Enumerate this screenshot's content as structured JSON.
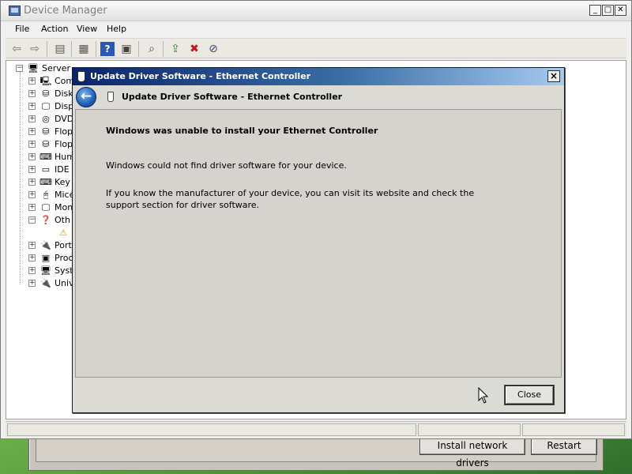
{
  "background_window": {
    "buttons": {
      "install_network_drivers": "Install network drivers",
      "restart": "Restart"
    }
  },
  "device_manager": {
    "title": "Device Manager",
    "menu": [
      "File",
      "Action",
      "View",
      "Help"
    ],
    "toolbar_icons": [
      "back-icon",
      "forward-icon",
      "show-hide-icon",
      "properties-icon",
      "help-icon",
      "action-icon",
      "scan-hardware-icon",
      "update-driver-icon",
      "uninstall-icon",
      "disable-icon"
    ],
    "tree": {
      "root": "Server",
      "nodes": [
        {
          "label": "Com",
          "expander": "+"
        },
        {
          "label": "Disk",
          "expander": "+"
        },
        {
          "label": "Disp",
          "expander": "+"
        },
        {
          "label": "DVD",
          "expander": "+"
        },
        {
          "label": "Flop",
          "expander": "+"
        },
        {
          "label": "Flop",
          "expander": "+"
        },
        {
          "label": "Hum",
          "expander": "+"
        },
        {
          "label": "IDE",
          "expander": "+"
        },
        {
          "label": "Key",
          "expander": "+"
        },
        {
          "label": "Mice",
          "expander": "+"
        },
        {
          "label": "Mon",
          "expander": "+"
        },
        {
          "label": "Oth",
          "expander": "−"
        },
        {
          "label": "",
          "expander": ""
        },
        {
          "label": "Port",
          "expander": "+"
        },
        {
          "label": "Proc",
          "expander": "+"
        },
        {
          "label": "Syst",
          "expander": "+"
        },
        {
          "label": "Univ",
          "expander": "+"
        }
      ]
    }
  },
  "dialog": {
    "title": "Update Driver Software - Ethernet Controller",
    "header_title": "Update Driver Software - Ethernet Controller",
    "heading": "Windows was unable to install your Ethernet Controller",
    "message1": "Windows could not find driver software for your device.",
    "message2": "If you know the manufacturer of your device, you can visit its website and check the support section for driver software.",
    "close_button": "Close",
    "close_glyph": "×",
    "back_glyph": "←"
  },
  "colors": {
    "dialog_title_start": "#0a246a",
    "dialog_title_end": "#a6caf0",
    "desktop_green": "#3d8a3a"
  }
}
